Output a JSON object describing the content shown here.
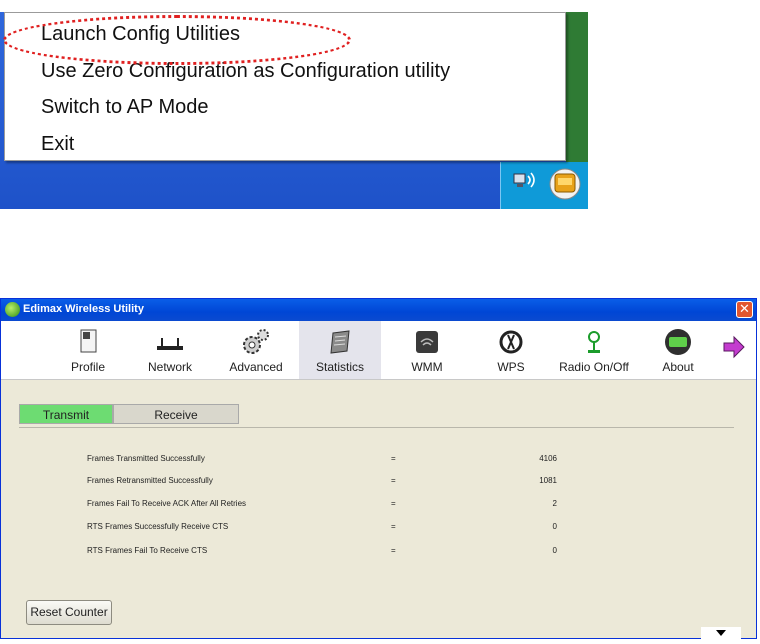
{
  "context_menu": {
    "items": [
      "Launch Config Utilities",
      "Use Zero Configuration as Configuration utility",
      "Switch to AP Mode",
      "Exit"
    ]
  },
  "window": {
    "title": "Edimax Wireless Utility",
    "close_glyph": "✕",
    "toolbar": [
      {
        "label": "Profile",
        "icon": "profile-icon"
      },
      {
        "label": "Network",
        "icon": "network-icon"
      },
      {
        "label": "Advanced",
        "icon": "gears-icon"
      },
      {
        "label": "Statistics",
        "icon": "statistics-icon"
      },
      {
        "label": "WMM",
        "icon": "wmm-icon"
      },
      {
        "label": "WPS",
        "icon": "wps-icon"
      },
      {
        "label": "Radio On/Off",
        "icon": "radio-icon"
      },
      {
        "label": "About",
        "icon": "about-icon"
      }
    ],
    "active_tool": "Statistics",
    "tabs": [
      "Transmit",
      "Receive"
    ],
    "active_tab": "Transmit",
    "stats": [
      {
        "label": "Frames Transmitted Successfully",
        "eq": "=",
        "value": "4106"
      },
      {
        "label": "Frames Retransmitted Successfully",
        "eq": "=",
        "value": "1081"
      },
      {
        "label": "Frames Fail To Receive ACK After All Retries",
        "eq": "=",
        "value": "2"
      },
      {
        "label": "RTS Frames Successfully Receive CTS",
        "eq": "=",
        "value": "0"
      },
      {
        "label": "RTS Frames Fail To Receive CTS",
        "eq": "=",
        "value": "0"
      }
    ],
    "reset_label": "Reset Counter",
    "colors": {
      "titlebar": "#0046d5",
      "tab_active": "#6ddc72",
      "highlight": "#e02020"
    }
  }
}
